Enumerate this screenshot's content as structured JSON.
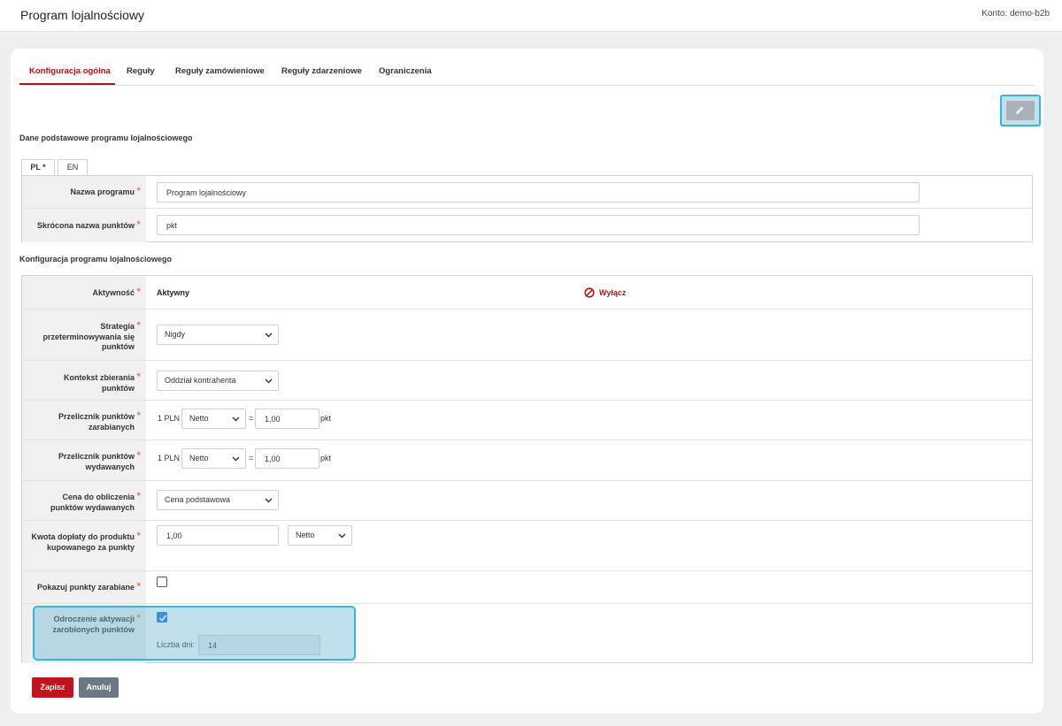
{
  "header": {
    "title": "Program lojalnościowy",
    "account": "Konto: demo-b2b"
  },
  "tabs": [
    {
      "label": "Konfiguracja ogólna",
      "active": true
    },
    {
      "label": "Reguły",
      "active": false
    },
    {
      "label": "Reguły zamówieniowe",
      "active": false
    },
    {
      "label": "Reguły zdarzeniowe",
      "active": false
    },
    {
      "label": "Ograniczenia",
      "active": false
    }
  ],
  "edit_button": {
    "icon": "pencil-icon"
  },
  "basic_section": {
    "title": "Dane podstawowe programu lojalnościowego",
    "lang_tabs": [
      "PL *",
      "EN"
    ],
    "program_name_label": "Nazwa programu",
    "program_name_value": "Program lojalnościowy",
    "short_points_label": "Skrócona nazwa punktów",
    "short_points_value": "pkt"
  },
  "config_section": {
    "title": "Konfiguracja programu lojalnościowego",
    "activity_label": "Aktywność",
    "activity_value": "Aktywny",
    "disable_label": "Wyłącz",
    "expiry_label": "Strategia przeterminowywania się punktów",
    "expiry_value": "Nigdy",
    "context_label": "Kontekst zbierania punktów",
    "context_value": "Oddział kontrahenta",
    "earn_label": "Przelicznik punktów zarabianych",
    "earn_prefix": "1 PLN",
    "earn_type": "Netto",
    "earn_equals": "=",
    "earn_value": "1,00",
    "earn_unit": "pkt",
    "spend_label": "Przelicznik punktów wydawanych",
    "spend_prefix": "1 PLN",
    "spend_type": "Netto",
    "spend_equals": "=",
    "spend_value": "1,00",
    "spend_unit": "pkt",
    "price_label": "Cena do obliczenia punktów wydawanych",
    "price_value": "Cena podstawowa",
    "surcharge_label": "Kwota dopłaty do produktu kupowanego za punkty",
    "surcharge_value": "1,00",
    "surcharge_type": "Netto",
    "show_points_label": "Pokazuj punkty zarabiane",
    "show_points_checked": false,
    "delay_label": "Odroczenie aktywacji zarobionych punktów",
    "delay_checked": true,
    "days_label": "Liczba dni:",
    "days_value": "14"
  },
  "footer": {
    "save_label": "Zapisz",
    "cancel_label": "Anuluj"
  },
  "colors": {
    "accent": "#b3141b",
    "required": "#e15b2d",
    "checkbox": "#1a73e8",
    "highlight_border": "#33b5e5",
    "cancel": "#6b7886"
  }
}
